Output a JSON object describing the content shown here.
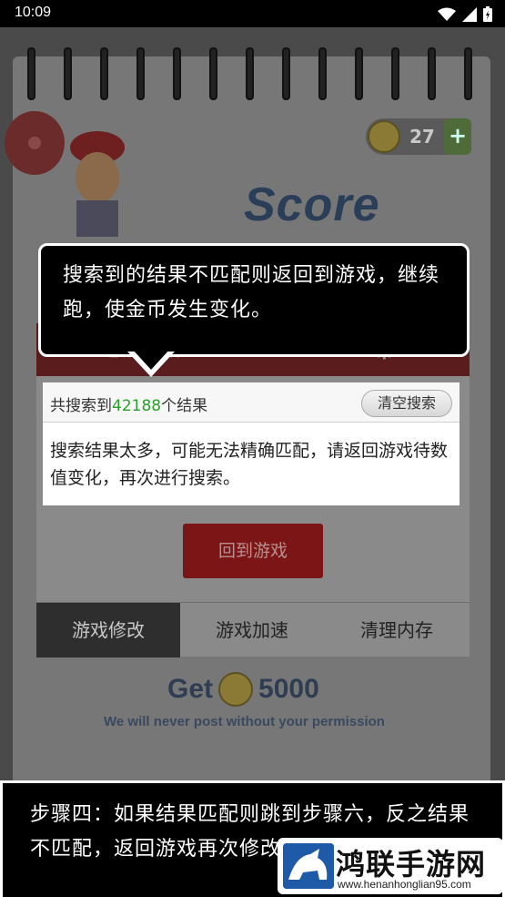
{
  "status_bar": {
    "time": "10:09"
  },
  "game_background": {
    "coin_count": "27",
    "coin_plus": "+",
    "score_title": "Score",
    "red_bar_text": "地铁跑酷",
    "get_prefix": "Get",
    "get_amount": "5000",
    "never_post": "We will never post without your permission"
  },
  "tooltip": {
    "text": "搜索到的结果不匹配则返回到游戏，继续跑，使金币发生变化。"
  },
  "search_result": {
    "prefix": "共搜索到",
    "count": "42188",
    "suffix": "个结果",
    "clear_label": "清空搜索",
    "message": "搜索结果太多，可能无法精确匹配，请返回游戏待数值变化，再次进行搜索。"
  },
  "return_button": {
    "label": "回到游戏"
  },
  "tabs": [
    {
      "label": "游戏修改",
      "active": true
    },
    {
      "label": "游戏加速",
      "active": false
    },
    {
      "label": "清理内存",
      "active": false
    }
  ],
  "caption": {
    "text": "步骤四：如果结果匹配则跳到步骤六，反之结果不匹配，返回游戏再次修改"
  },
  "watermark": {
    "title": "鸿联手游网",
    "url": "www.henanhonglian95.com"
  },
  "colors": {
    "accent_green": "#2aa02a",
    "button_red": "#7c1515"
  }
}
